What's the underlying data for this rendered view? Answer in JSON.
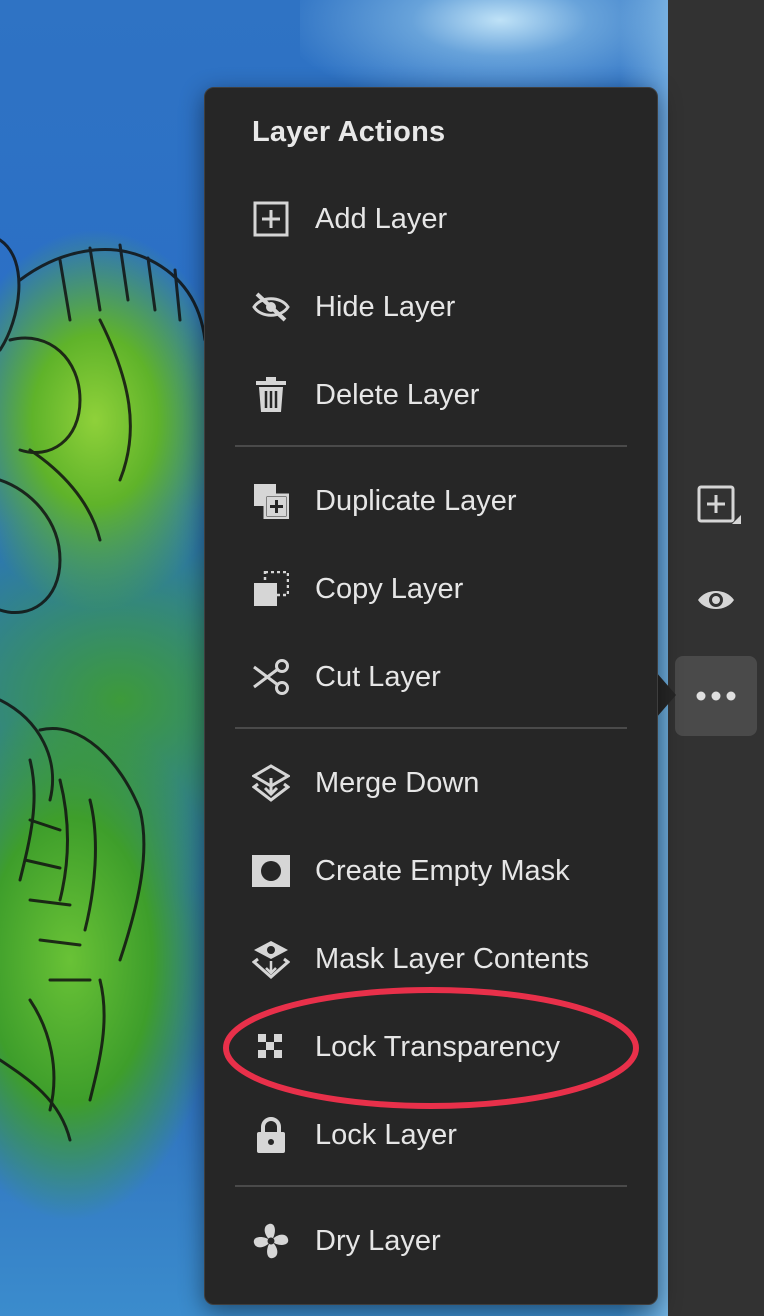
{
  "canvas": {
    "description_icon": "artwork-turtle"
  },
  "menu": {
    "title": "Layer Actions",
    "items": [
      {
        "label": "Add Layer",
        "icon": "add-layer-icon"
      },
      {
        "label": "Hide Layer",
        "icon": "hide-icon"
      },
      {
        "label": "Delete Layer",
        "icon": "trash-icon"
      },
      {
        "label": "Duplicate Layer",
        "icon": "duplicate-icon"
      },
      {
        "label": "Copy Layer",
        "icon": "copy-icon"
      },
      {
        "label": "Cut Layer",
        "icon": "scissors-icon"
      },
      {
        "label": "Merge Down",
        "icon": "merge-down-icon"
      },
      {
        "label": "Create Empty Mask",
        "icon": "mask-icon"
      },
      {
        "label": "Mask Layer Contents",
        "icon": "mask-contents-icon"
      },
      {
        "label": "Lock Transparency",
        "icon": "checkerboard-icon",
        "highlighted": true
      },
      {
        "label": "Lock Layer",
        "icon": "lock-icon"
      },
      {
        "label": "Dry Layer",
        "icon": "fan-icon"
      }
    ]
  },
  "toolbar": {
    "buttons": [
      {
        "name": "add-layer",
        "icon": "add-layer-icon"
      },
      {
        "name": "visibility",
        "icon": "eye-icon"
      },
      {
        "name": "more-actions",
        "icon": "more-icon",
        "active": true
      }
    ]
  },
  "colors": {
    "menu_bg": "#262626",
    "rail_bg": "#323232",
    "text": "#e6e6e6",
    "annotation": "#e8304a"
  }
}
